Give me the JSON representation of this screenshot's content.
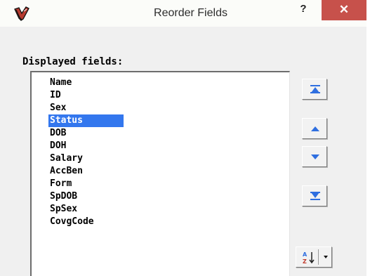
{
  "window": {
    "title": "Reorder Fields",
    "help_label": "?",
    "close_label": "✕"
  },
  "colors": {
    "selection": "#3377ee",
    "close_button": "#c7514b",
    "arrow_blue": "#2f6fe0"
  },
  "icons": {
    "app": "feather-quill-icon",
    "move_top": "move-to-top-icon",
    "move_up": "move-up-icon",
    "move_down": "move-down-icon",
    "move_bottom": "move-to-bottom-icon",
    "sort": "sort-az-icon",
    "sort_dropdown": "chevron-down-icon"
  },
  "fields": {
    "label": "Displayed fields:",
    "selected": "Status",
    "items": [
      "Name",
      "ID",
      "Sex",
      "Status",
      "DOB",
      "DOH",
      "Salary",
      "AccBen",
      "Form",
      "SpDOB",
      "SpSex",
      "CovgCode"
    ]
  }
}
